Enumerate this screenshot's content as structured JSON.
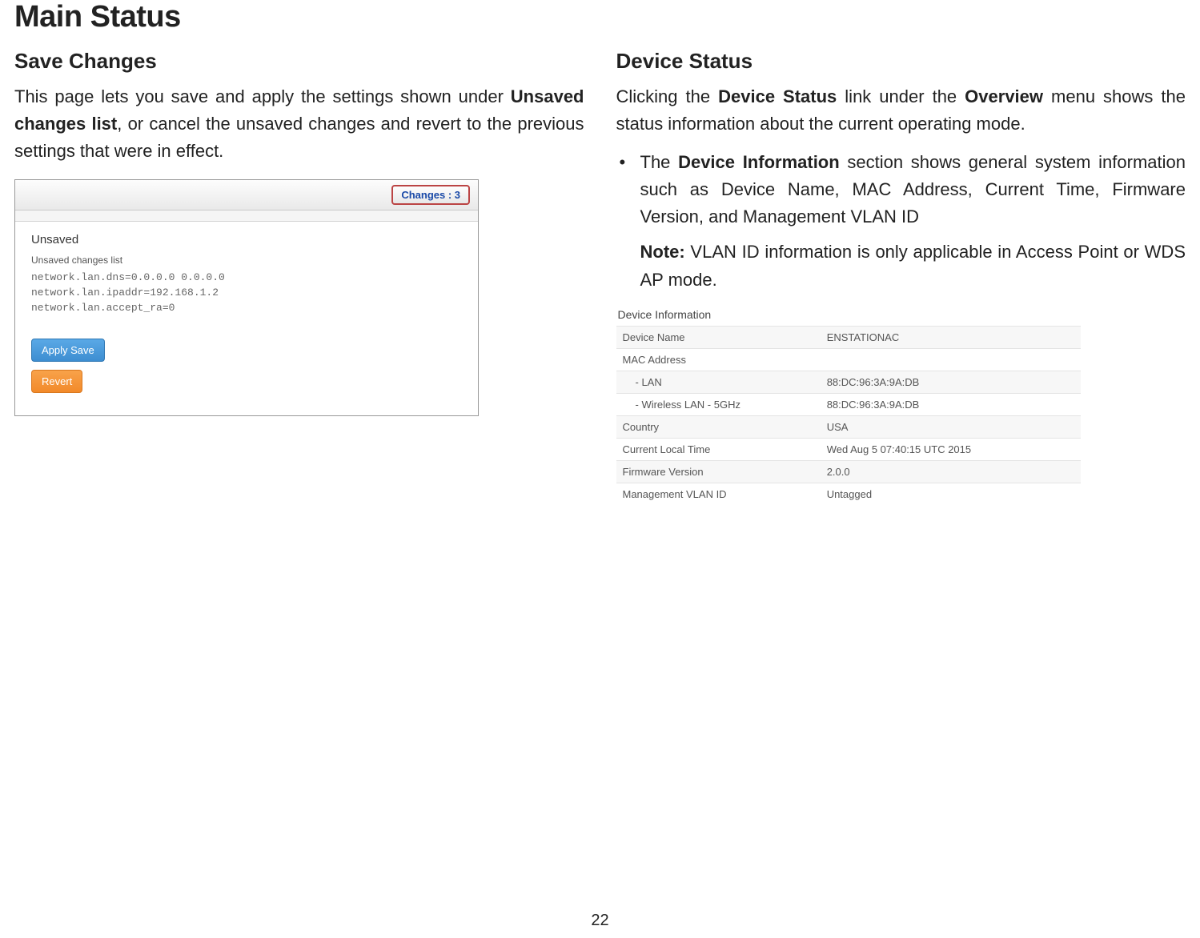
{
  "page": {
    "title": "Main Status",
    "number": "22"
  },
  "left": {
    "heading": "Save Changes",
    "para_pre": "This page lets you save and apply the settings shown under ",
    "para_bold": "Unsaved changes list",
    "para_post": ", or cancel the unsaved changes and revert to the previous settings that were in effect.",
    "screenshot": {
      "changes_label": "Changes : 3",
      "unsaved_heading": "Unsaved",
      "list_label": "Unsaved changes list",
      "line1": "network.lan.dns=0.0.0.0 0.0.0.0",
      "line2": "network.lan.ipaddr=192.168.1.2",
      "line3": "network.lan.accept_ra=0",
      "apply_label": "Apply Save",
      "revert_label": "Revert"
    }
  },
  "right": {
    "heading": "Device Status",
    "lead_pre": "Clicking the ",
    "lead_b1": "Device Status",
    "lead_mid": " link under the ",
    "lead_b2": "Overview",
    "lead_post": " menu shows the status information about the current operating mode.",
    "bullet_pre": "The ",
    "bullet_bold": "Device Information",
    "bullet_post": " section shows general system information such as Device Name, MAC Address, Current Time, Firmware Version, and Management VLAN ID",
    "note_label": "Note:",
    "note_text": " VLAN ID information is only applicable in Access Point or WDS AP mode.",
    "table": {
      "title": "Device Information",
      "rows": {
        "device_name_k": "Device Name",
        "device_name_v": "ENSTATIONAC",
        "mac_k": "MAC Address",
        "mac_v": "",
        "lan_k": "- LAN",
        "lan_v": "88:DC:96:3A:9A:DB",
        "wlan_k": "- Wireless LAN - 5GHz",
        "wlan_v": "88:DC:96:3A:9A:DB",
        "country_k": "Country",
        "country_v": "USA",
        "time_k": "Current Local Time",
        "time_v": "Wed Aug 5 07:40:15 UTC 2015",
        "fw_k": "Firmware Version",
        "fw_v": "2.0.0",
        "vlan_k": "Management VLAN ID",
        "vlan_v": "Untagged"
      }
    }
  }
}
